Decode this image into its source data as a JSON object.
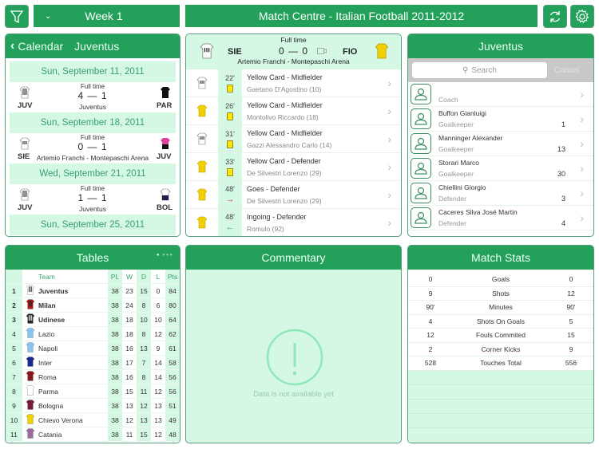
{
  "topbar": {
    "week_label": "Week 1",
    "title": "Match Centre - Italian Football 2011-2012",
    "filter_icon": "filter-icon",
    "refresh_icon": "refresh-icon",
    "settings_icon": "gear-icon"
  },
  "calendar": {
    "back_label": "Calendar",
    "team": "Juventus",
    "entries": [
      {
        "date": "Sun, September 11, 2011",
        "status": "Full time",
        "home": "JUV",
        "away": "PAR",
        "score": "4 — 1",
        "venue": "Juventus"
      },
      {
        "date": "Sun, September 18, 2011",
        "status": "Full time",
        "home": "SIE",
        "away": "JUV",
        "score": "0 — 1",
        "venue": "Artemio Franchi - Montepaschi Arena"
      },
      {
        "date": "Wed, September 21, 2011",
        "status": "Full time",
        "home": "JUV",
        "away": "BOL",
        "score": "1 — 1",
        "venue": "Juventus"
      },
      {
        "date": "Sun, September 25, 2011"
      }
    ]
  },
  "match": {
    "status": "Full time",
    "home": "SIE",
    "away": "FIO",
    "score": "0 — 0",
    "venue": "Artemio Franchi - Montepaschi Arena",
    "events": [
      {
        "minute": "22'",
        "title": "Yellow Card - Midfielder",
        "player": "Gaetano D'Agostino (10)",
        "team": "home",
        "type": "yellow"
      },
      {
        "minute": "26'",
        "title": "Yellow Card - Midfielder",
        "player": "Montolivo Riccardo (18)",
        "team": "away",
        "type": "yellow"
      },
      {
        "minute": "31'",
        "title": "Yellow Card - Midfielder",
        "player": "Gazzi Alessandro Carlo (14)",
        "team": "home",
        "type": "yellow"
      },
      {
        "minute": "33'",
        "title": "Yellow Card - Defender",
        "player": "De Silvestri Lorenzo (29)",
        "team": "away",
        "type": "yellow"
      },
      {
        "minute": "48'",
        "title": "Goes - Defender",
        "player": "De Silvestri Lorenzo (29)",
        "team": "away",
        "type": "out",
        "symbol": "→"
      },
      {
        "minute": "48'",
        "title": "Ingoing - Defender",
        "player": "Romulo (92)",
        "team": "away",
        "type": "in",
        "symbol": "←"
      }
    ]
  },
  "squad": {
    "title": "Juventus",
    "search_placeholder": "Search",
    "cancel_label": "Cancel",
    "players": [
      {
        "name": "",
        "role": "Coach",
        "number": ""
      },
      {
        "name": "Buffon Gianluigi",
        "role": "Goalkeeper",
        "number": "1"
      },
      {
        "name": "Manninger Alexander",
        "role": "Goalkeeper",
        "number": "13"
      },
      {
        "name": "Storari Marco",
        "role": "Goalkeeper",
        "number": "30"
      },
      {
        "name": "Chiellini Giorgio",
        "role": "Defender",
        "number": "3"
      },
      {
        "name": "Caceres Silva José Martin",
        "role": "Defender",
        "number": "4"
      }
    ]
  },
  "tables": {
    "title": "Tables",
    "headers": [
      "",
      "",
      "Team",
      "PL",
      "W",
      "D",
      "L",
      "Pts"
    ],
    "rows": [
      {
        "pos": "1",
        "team": "Juventus",
        "pl": "38",
        "w": "23",
        "d": "15",
        "l": "0",
        "pts": "84",
        "bold": true,
        "kit": "#ffffff",
        "stripe": "#222"
      },
      {
        "pos": "2",
        "team": "Milan",
        "pl": "38",
        "w": "24",
        "d": "8",
        "l": "6",
        "pts": "80",
        "bold": true,
        "kit": "#b01818",
        "stripe": "#222"
      },
      {
        "pos": "3",
        "team": "Udinese",
        "pl": "38",
        "w": "18",
        "d": "10",
        "l": "10",
        "pts": "64",
        "bold": true,
        "kit": "#222222",
        "stripe": "#fff"
      },
      {
        "pos": "4",
        "team": "Lazio",
        "pl": "38",
        "w": "18",
        "d": "8",
        "l": "12",
        "pts": "62",
        "kit": "#88c4f0"
      },
      {
        "pos": "5",
        "team": "Napoli",
        "pl": "38",
        "w": "16",
        "d": "13",
        "l": "9",
        "pts": "61",
        "kit": "#88c4f0"
      },
      {
        "pos": "6",
        "team": "Inter",
        "pl": "38",
        "w": "17",
        "d": "7",
        "l": "14",
        "pts": "58",
        "kit": "#1a2a8a"
      },
      {
        "pos": "7",
        "team": "Roma",
        "pl": "38",
        "w": "16",
        "d": "8",
        "l": "14",
        "pts": "56",
        "kit": "#8a1a1a"
      },
      {
        "pos": "8",
        "team": "Parma",
        "pl": "38",
        "w": "15",
        "d": "11",
        "l": "12",
        "pts": "56",
        "kit": "#ffffff"
      },
      {
        "pos": "9",
        "team": "Bologna",
        "pl": "38",
        "w": "13",
        "d": "12",
        "l": "13",
        "pts": "51",
        "kit": "#7a1a3a"
      },
      {
        "pos": "10",
        "team": "Chievo Verona",
        "pl": "38",
        "w": "12",
        "d": "13",
        "l": "13",
        "pts": "49",
        "kit": "#f0d000"
      },
      {
        "pos": "11",
        "team": "Catania",
        "pl": "38",
        "w": "11",
        "d": "15",
        "l": "12",
        "pts": "48",
        "kit": "#9a6aa0"
      }
    ]
  },
  "commentary": {
    "title": "Commentary",
    "empty_message": "Data is not available yet"
  },
  "stats": {
    "title": "Match Stats",
    "rows": [
      {
        "home": "0",
        "label": "Goals",
        "away": "0"
      },
      {
        "home": "9",
        "label": "Shots",
        "away": "12"
      },
      {
        "home": "90'",
        "label": "Minutes",
        "away": "90'"
      },
      {
        "home": "4",
        "label": "Shots On Goals",
        "away": "5"
      },
      {
        "home": "12",
        "label": "Fouls Commited",
        "away": "15"
      },
      {
        "home": "2",
        "label": "Corner Kicks",
        "away": "9"
      },
      {
        "home": "528",
        "label": "Touches Total",
        "away": "556"
      }
    ]
  },
  "colors": {
    "accent": "#23a05a",
    "light": "#d4f8e4",
    "border": "#5a9c7c",
    "yellow_card": "#ffe800"
  }
}
